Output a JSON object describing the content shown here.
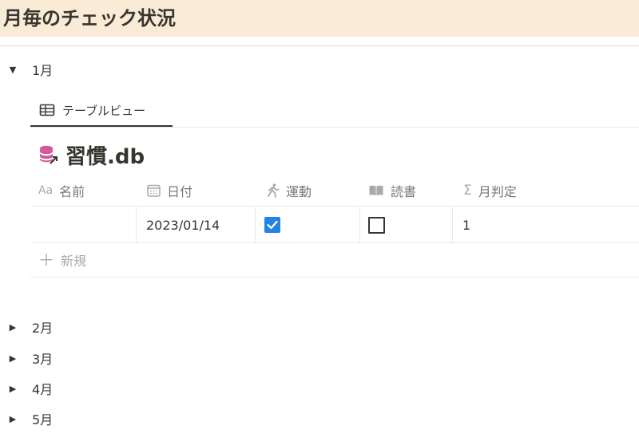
{
  "page": {
    "title": "月毎のチェック状況"
  },
  "toggles": [
    {
      "label": "1月",
      "expanded": true
    },
    {
      "label": "2月",
      "expanded": false
    },
    {
      "label": "3月",
      "expanded": false
    },
    {
      "label": "4月",
      "expanded": false
    },
    {
      "label": "5月",
      "expanded": false
    }
  ],
  "view": {
    "tab_label": "テーブルビュー",
    "tab_icon": "table-icon"
  },
  "database": {
    "title": "習慣.db",
    "icon": "linked-database-icon",
    "icon_color": "#d3589b"
  },
  "table": {
    "columns": [
      {
        "label": "名前",
        "icon": "title-property-icon",
        "icon_text": "Aa"
      },
      {
        "label": "日付",
        "icon": "calendar-icon"
      },
      {
        "label": "運動",
        "icon": "running-person-icon"
      },
      {
        "label": "読書",
        "icon": "book-icon"
      },
      {
        "label": "月判定",
        "icon": "sigma-icon",
        "icon_text": "Σ"
      }
    ],
    "rows": [
      {
        "name": "",
        "date": "2023/01/14",
        "exercise": true,
        "reading": false,
        "month_judgement": "1"
      }
    ],
    "new_label": "新規",
    "new_icon_text": "＋"
  },
  "colors": {
    "title_bg": "#faebd7",
    "checkbox_accent": "#2383e2",
    "text": "#37352f",
    "muted": "#787774"
  }
}
